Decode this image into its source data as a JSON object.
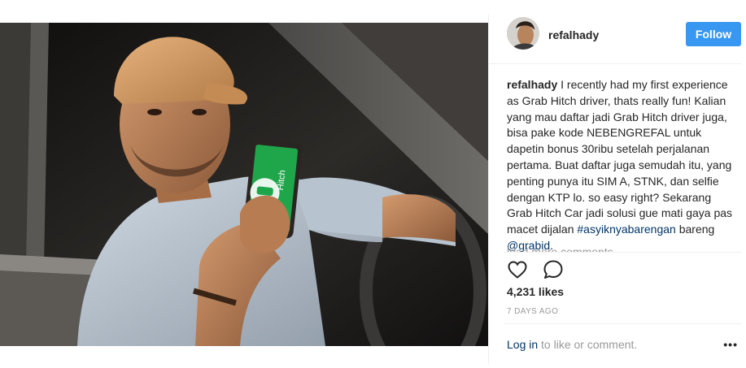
{
  "header": {
    "username": "refalhady",
    "follow_label": "Follow"
  },
  "caption": {
    "username": "refalhady",
    "text": "I recently had my first experience as Grab Hitch driver, thats really fun! Kalian yang mau daftar jadi Grab Hitch driver juga, bisa pake kode NEBENGREFAL untuk dapetin bonus 30ribu setelah perjalanan pertama. Buat daftar juga semudah itu, yang penting punya itu SIM A, STNK, dan selfie dengan KTP lo. so easy right? Sekarang Grab Hitch Car jadi solusi gue mati gaya pas macet dijalan",
    "hashtag": "#asyiknyabarengan",
    "connector": "bareng",
    "mention": "@grabid",
    "end": "."
  },
  "load_more_label": "load more comments",
  "actions": {
    "like_icon": "heart-outline-icon",
    "comment_icon": "speech-bubble-icon"
  },
  "likes_label": "4,231 likes",
  "date_label": "7 DAYS AGO",
  "login": {
    "link": "Log in",
    "rest": "to like or comment.",
    "more_label": "•••"
  },
  "photo": {
    "app_text": "Hitch",
    "accent": "#1fa64a"
  },
  "colors": {
    "follow_button": "#3897f0",
    "link": "#003569",
    "muted": "#999999"
  }
}
